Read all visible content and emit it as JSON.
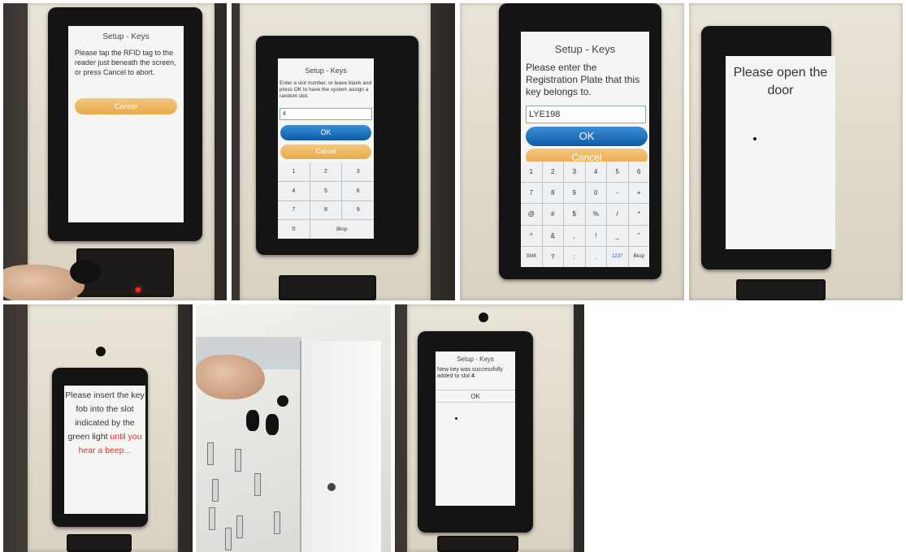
{
  "panel1": {
    "title": "Setup - Keys",
    "message": "Please tap the RFID tag to the reader just beneath the screen, or press Cancel to abort.",
    "cancel_label": "Cancel"
  },
  "panel2": {
    "title": "Setup - Keys",
    "message": "Enter a slot number, or leave blank and press OK to have the system assign a random slot.",
    "input_value": "4",
    "ok_label": "OK",
    "cancel_label": "Cancel",
    "keys": [
      "1",
      "2",
      "3",
      "4",
      "5",
      "6",
      "7",
      "8",
      "9",
      "0",
      "Bksp"
    ]
  },
  "panel3": {
    "title": "Setup - Keys",
    "message": "Please enter the Registration Plate that this key belongs to.",
    "input_value": "LYE198",
    "ok_label": "OK",
    "cancel_label": "Cancel",
    "keys": [
      "1",
      "2",
      "3",
      "4",
      "5",
      "6",
      "7",
      "8",
      "9",
      "0",
      "-",
      "+",
      "@",
      "#",
      "$",
      "%",
      "/",
      "*",
      "^",
      "&",
      ",",
      "!",
      "_",
      "\"",
      "Shift",
      "?",
      ":",
      ".",
      "123?",
      "Bksp"
    ]
  },
  "panel4": {
    "message": "Please open the door"
  },
  "panel5": {
    "message_main": "Please insert the key fob into the slot indicated by the green light",
    "message_highlight": "until you hear a beep..."
  },
  "panel7": {
    "title": "Setup - Keys",
    "message_prefix": "New key was successfully added to slot ",
    "slot_number": "4",
    "message_suffix": ".",
    "ok_label": "OK"
  },
  "colors": {
    "accent_blue": "#0f5aa6",
    "accent_orange": "#e9a94b",
    "highlight_red": "#e0302a"
  }
}
